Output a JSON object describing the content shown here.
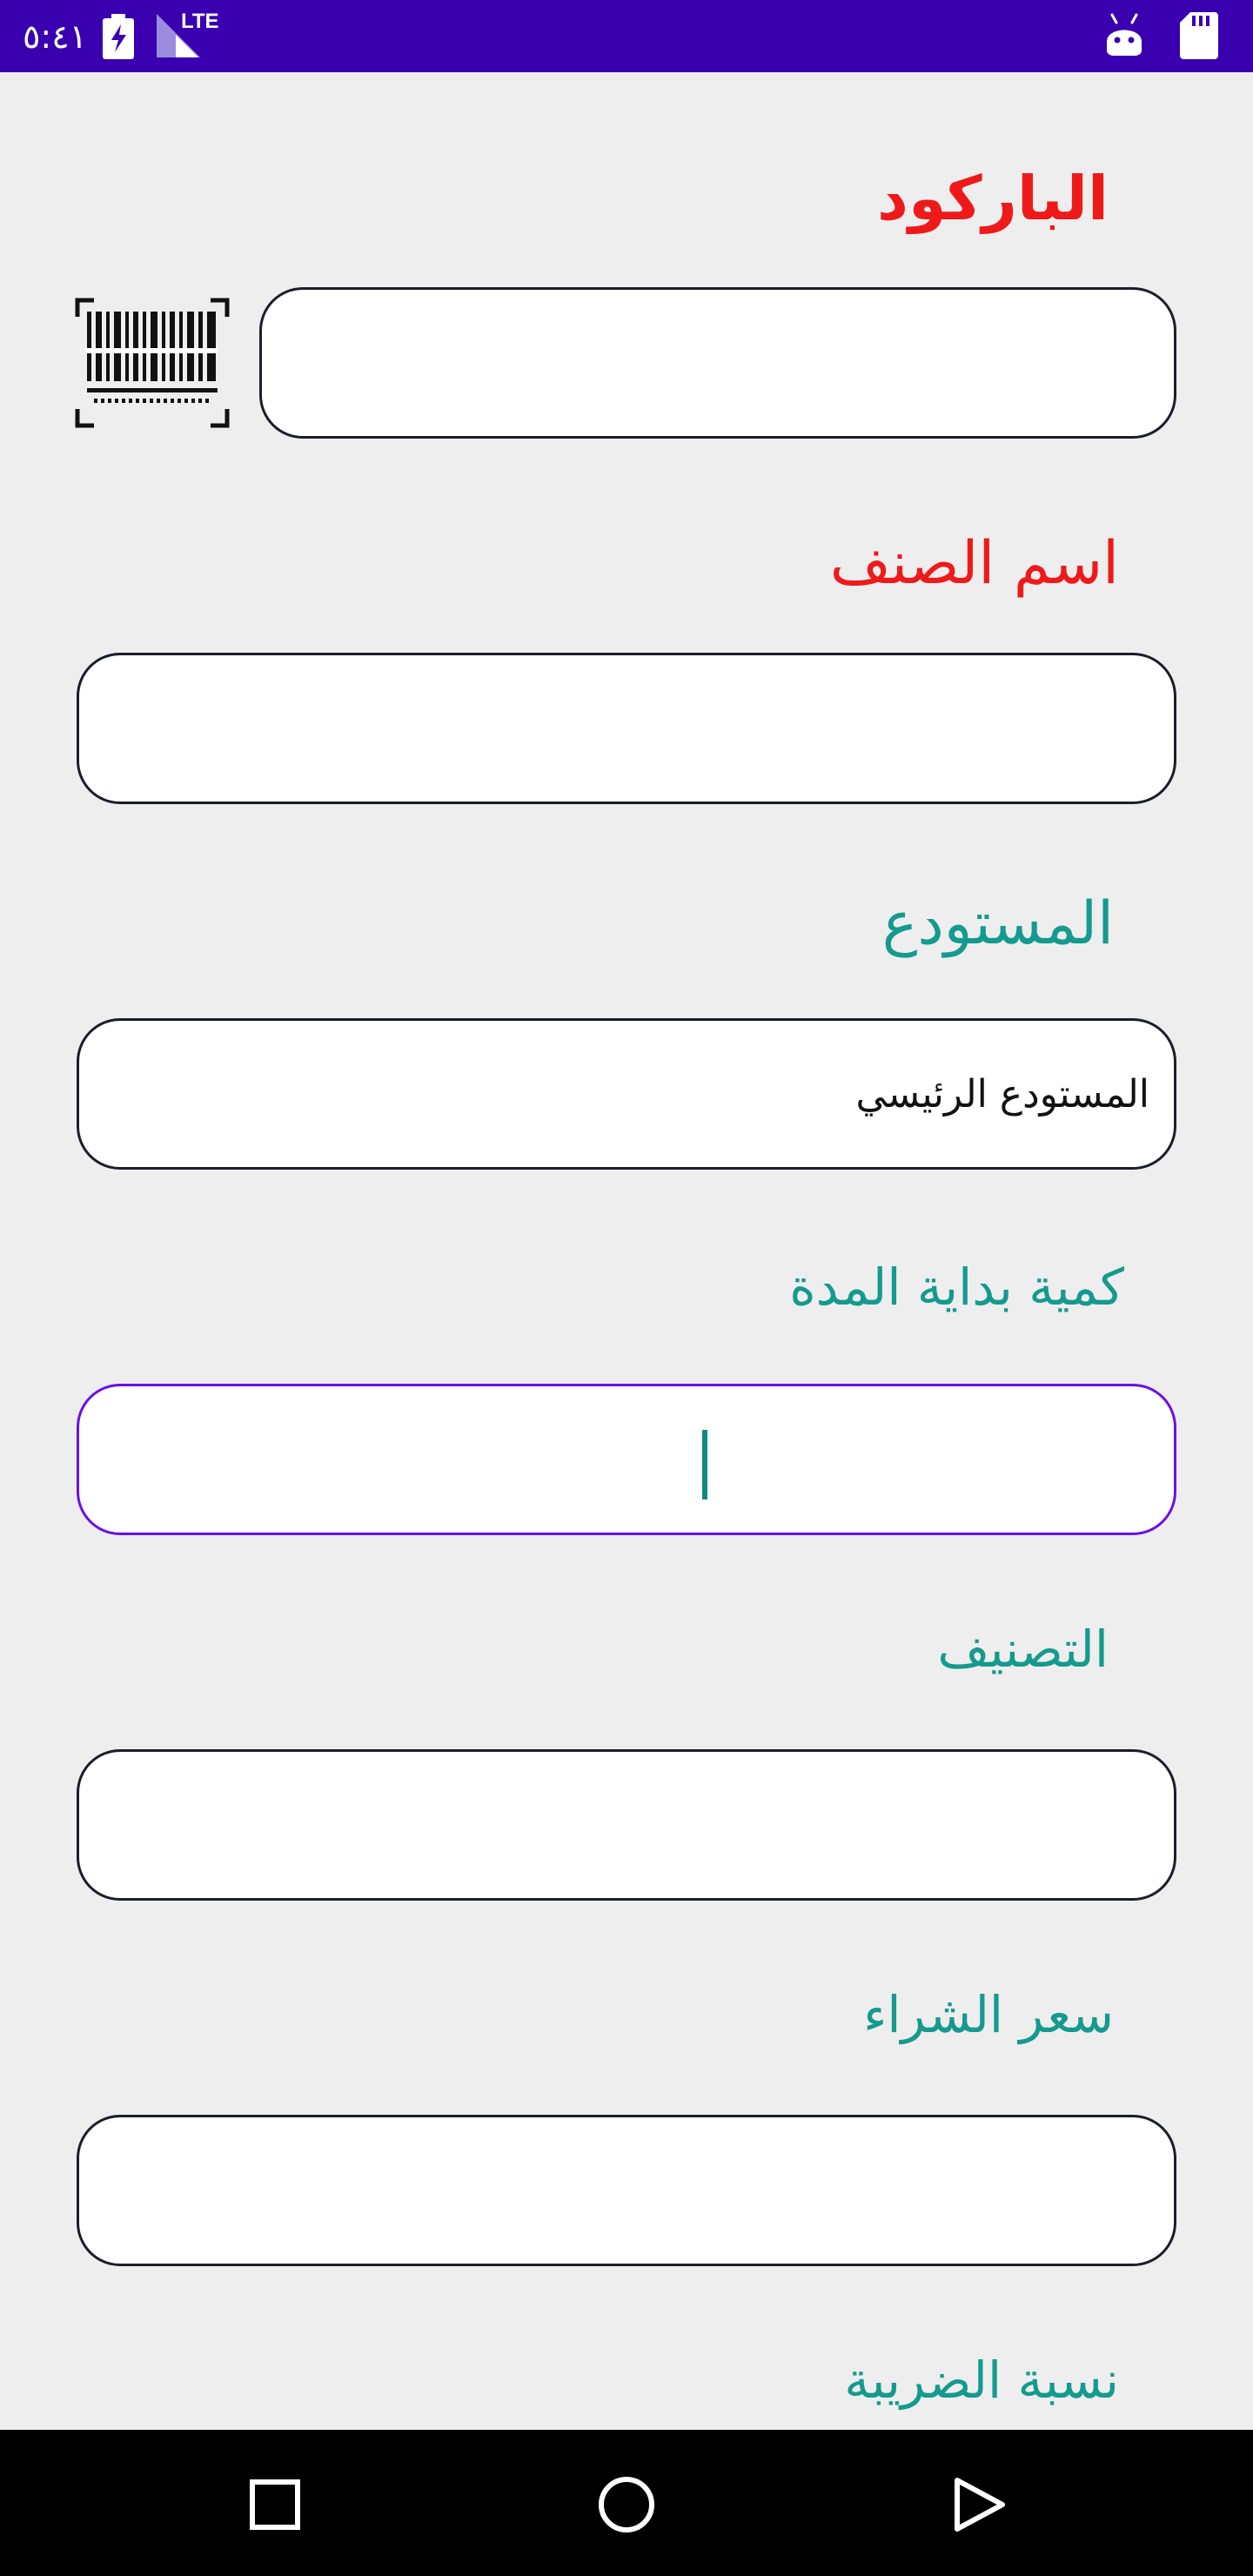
{
  "status_bar": {
    "time": "٥:٤١",
    "network": "LTE",
    "icons": [
      "battery-charging-icon",
      "signal-icon",
      "android-icon",
      "sd-card-icon"
    ]
  },
  "form": {
    "barcode": {
      "label": "الباركود",
      "value": "",
      "scan_icon": "barcode-scan-icon"
    },
    "item_name": {
      "label": "اسم الصنف",
      "value": ""
    },
    "warehouse": {
      "label": "المستودع",
      "value": "المستودع الرئيسي"
    },
    "opening_quantity": {
      "label": "كمية بداية المدة",
      "value": ""
    },
    "category": {
      "label": "التصنيف",
      "value": ""
    },
    "purchase_price": {
      "label": "سعر الشراء",
      "value": ""
    },
    "tax_rate": {
      "label": "نسبة الضريبة"
    }
  },
  "nav_bar": {
    "icons": [
      "recents-square-icon",
      "home-circle-icon",
      "back-triangle-icon"
    ]
  },
  "colors": {
    "status_bar": "#3a00b0",
    "required_label": "#ee1a1a",
    "optional_label": "#149a8e",
    "focus_border": "#6a10e8",
    "background": "#eeeeee"
  }
}
